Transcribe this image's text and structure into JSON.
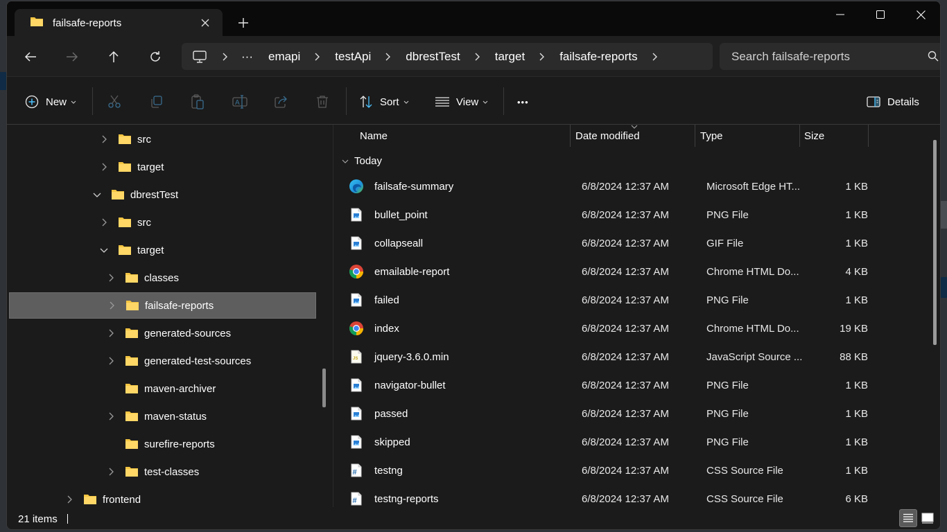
{
  "window": {
    "tab_title": "failsafe-reports",
    "controls": {
      "minimize": "minimize",
      "maximize": "maximize",
      "close": "close"
    }
  },
  "nav": {
    "breadcrumb": [
      "emapi",
      "testApi",
      "dbrestTest",
      "target",
      "failsafe-reports"
    ],
    "overflow_label": "···",
    "search_placeholder": "Search failsafe-reports"
  },
  "toolbar": {
    "new_label": "New",
    "sort_label": "Sort",
    "view_label": "View",
    "more_label": "•••",
    "details_label": "Details"
  },
  "sidebar": {
    "items": [
      {
        "label": "src",
        "level": 3,
        "expander": "collapsed"
      },
      {
        "label": "target",
        "level": 3,
        "expander": "collapsed"
      },
      {
        "label": "dbrestTest",
        "level": 2,
        "expander": "expanded"
      },
      {
        "label": "src",
        "level": 3,
        "expander": "collapsed"
      },
      {
        "label": "target",
        "level": 3,
        "expander": "expanded"
      },
      {
        "label": "classes",
        "level": 4,
        "expander": "collapsed"
      },
      {
        "label": "failsafe-reports",
        "level": 4,
        "expander": "collapsed",
        "selected": true
      },
      {
        "label": "generated-sources",
        "level": 4,
        "expander": "collapsed"
      },
      {
        "label": "generated-test-sources",
        "level": 4,
        "expander": "collapsed"
      },
      {
        "label": "maven-archiver",
        "level": 4,
        "expander": "none"
      },
      {
        "label": "maven-status",
        "level": 4,
        "expander": "collapsed"
      },
      {
        "label": "surefire-reports",
        "level": 4,
        "expander": "none"
      },
      {
        "label": "test-classes",
        "level": 4,
        "expander": "collapsed"
      },
      {
        "label": "frontend",
        "level": 1,
        "expander": "collapsed"
      }
    ]
  },
  "filelist": {
    "columns": {
      "name": "Name",
      "date": "Date modified",
      "type": "Type",
      "size": "Size"
    },
    "group": "Today",
    "rows": [
      {
        "name": "failsafe-summary",
        "date": "6/8/2024 12:37 AM",
        "type": "Microsoft Edge HT...",
        "size": "1 KB",
        "icon": "edge-icon"
      },
      {
        "name": "bullet_point",
        "date": "6/8/2024 12:37 AM",
        "type": "PNG File",
        "size": "1 KB",
        "icon": "image-file-icon"
      },
      {
        "name": "collapseall",
        "date": "6/8/2024 12:37 AM",
        "type": "GIF File",
        "size": "1 KB",
        "icon": "image-file-icon"
      },
      {
        "name": "emailable-report",
        "date": "6/8/2024 12:37 AM",
        "type": "Chrome HTML Do...",
        "size": "4 KB",
        "icon": "chrome-icon"
      },
      {
        "name": "failed",
        "date": "6/8/2024 12:37 AM",
        "type": "PNG File",
        "size": "1 KB",
        "icon": "image-file-icon"
      },
      {
        "name": "index",
        "date": "6/8/2024 12:37 AM",
        "type": "Chrome HTML Do...",
        "size": "19 KB",
        "icon": "chrome-icon"
      },
      {
        "name": "jquery-3.6.0.min",
        "date": "6/8/2024 12:37 AM",
        "type": "JavaScript Source ...",
        "size": "88 KB",
        "icon": "js-file-icon"
      },
      {
        "name": "navigator-bullet",
        "date": "6/8/2024 12:37 AM",
        "type": "PNG File",
        "size": "1 KB",
        "icon": "image-file-icon"
      },
      {
        "name": "passed",
        "date": "6/8/2024 12:37 AM",
        "type": "PNG File",
        "size": "1 KB",
        "icon": "image-file-icon"
      },
      {
        "name": "skipped",
        "date": "6/8/2024 12:37 AM",
        "type": "PNG File",
        "size": "1 KB",
        "icon": "image-file-icon"
      },
      {
        "name": "testng",
        "date": "6/8/2024 12:37 AM",
        "type": "CSS Source File",
        "size": "1 KB",
        "icon": "css-file-icon"
      },
      {
        "name": "testng-reports",
        "date": "6/8/2024 12:37 AM",
        "type": "CSS Source File",
        "size": "6 KB",
        "icon": "css-file-icon"
      }
    ]
  },
  "status": {
    "item_count": "21 items"
  },
  "colors": {
    "folder": "#f4c542",
    "accent": "#4cc2ff",
    "selection": "#5e5e5e"
  }
}
